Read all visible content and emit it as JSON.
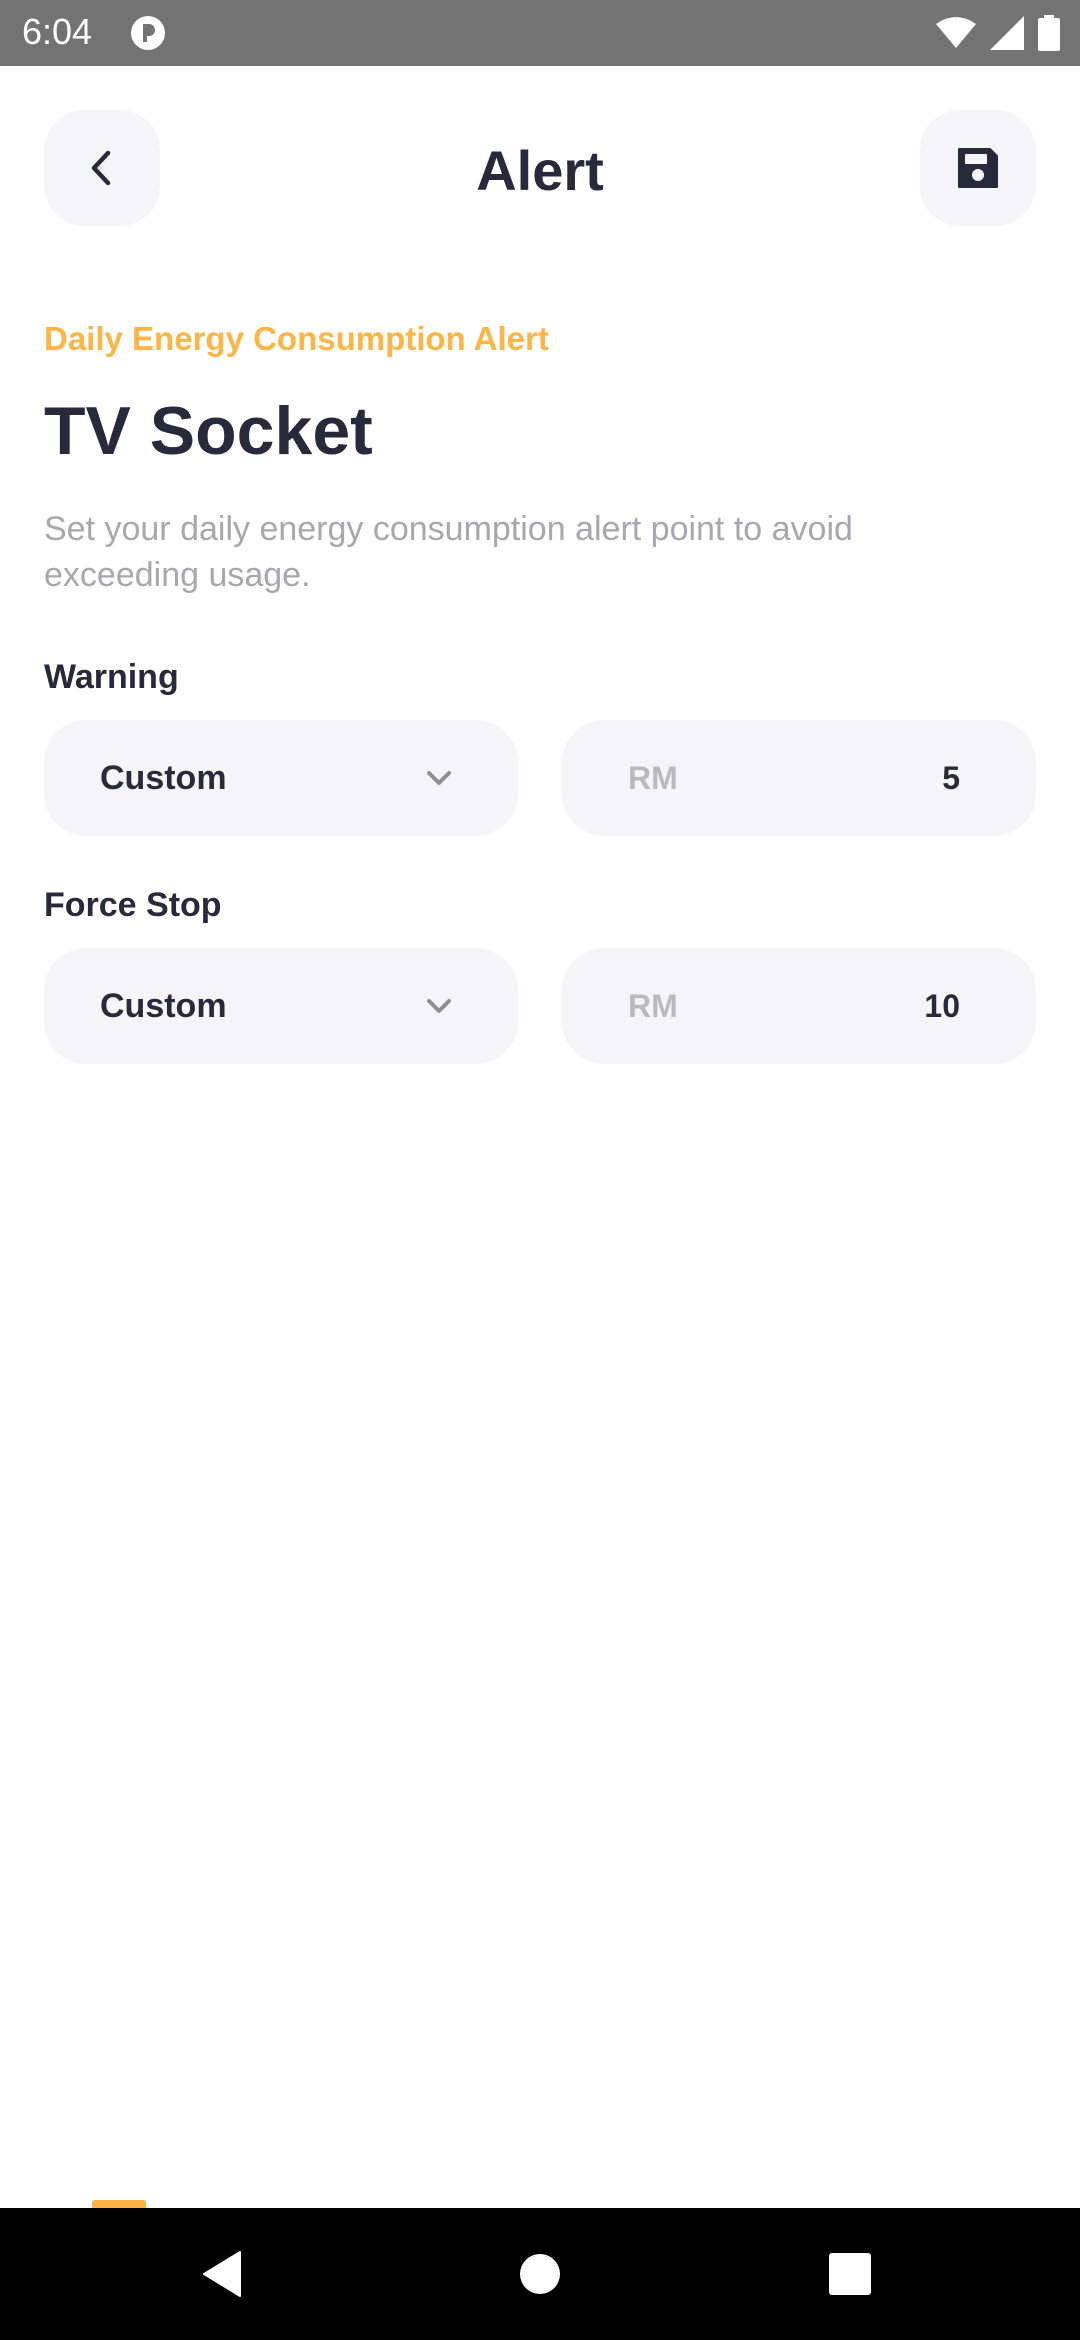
{
  "status_bar": {
    "time": "6:04",
    "app_icon": "pocket-icon",
    "icons": [
      "wifi-icon",
      "signal-icon",
      "battery-icon"
    ]
  },
  "header": {
    "title": "Alert",
    "back_icon": "chevron-left-icon",
    "save_icon": "floppy-disk-icon"
  },
  "alert": {
    "eyebrow": "Daily Energy Consumption Alert",
    "device_name": "TV Socket",
    "description": "Set your daily energy consumption alert point to avoid exceeding usage."
  },
  "warning": {
    "label": "Warning",
    "mode": "Custom",
    "currency": "RM",
    "amount": "5"
  },
  "force_stop": {
    "label": "Force Stop",
    "mode": "Custom",
    "currency": "RM",
    "amount": "10"
  },
  "colors": {
    "accent": "#ffb545",
    "text_primary": "#262a3b",
    "text_muted": "#a7a7ad",
    "field_bg": "#f5f5f7"
  },
  "nav_bar": {
    "buttons": [
      "back-triangle-icon",
      "home-circle-icon",
      "recents-square-icon"
    ]
  }
}
